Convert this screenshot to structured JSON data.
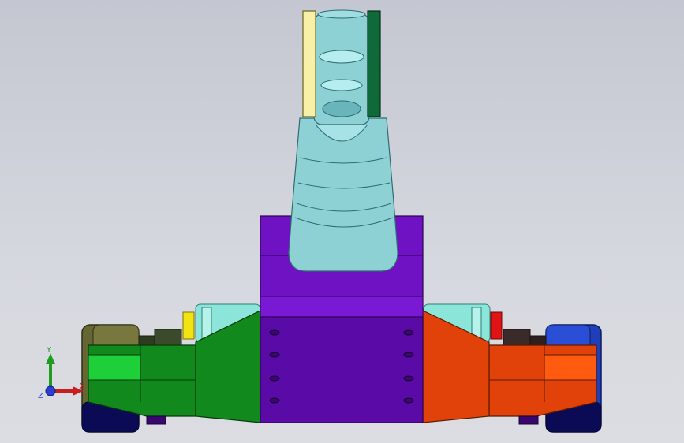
{
  "viewport": {
    "background_top": "#c4c7d1",
    "background_bottom": "#dcdde2"
  },
  "model": {
    "colors": {
      "arm": "#8ed1d5",
      "arm_dark": "#5fa7ae",
      "clamp_yellow": "#f7f0a8",
      "clamp_green": "#0f6a3a",
      "body_purple": "#6f12c3",
      "body_purple_dark": "#4d0a8a",
      "left_green": "#12891c",
      "left_green_light": "#1ecf3a",
      "right_orange": "#e0420a",
      "right_orange_light": "#ff5b0f",
      "wheel_left": "#666633",
      "wheel_right": "#1f3fb8",
      "bearing_cyan": "#8be6d9",
      "yellow_gear": "#f2e312",
      "red_gear": "#e01414"
    }
  },
  "triad": {
    "y_label": "Y",
    "x_label": "X",
    "z_label": "Z",
    "y_color": "#1f9d1f",
    "x_color": "#c81e1e",
    "z_color": "#2a3fd0"
  }
}
